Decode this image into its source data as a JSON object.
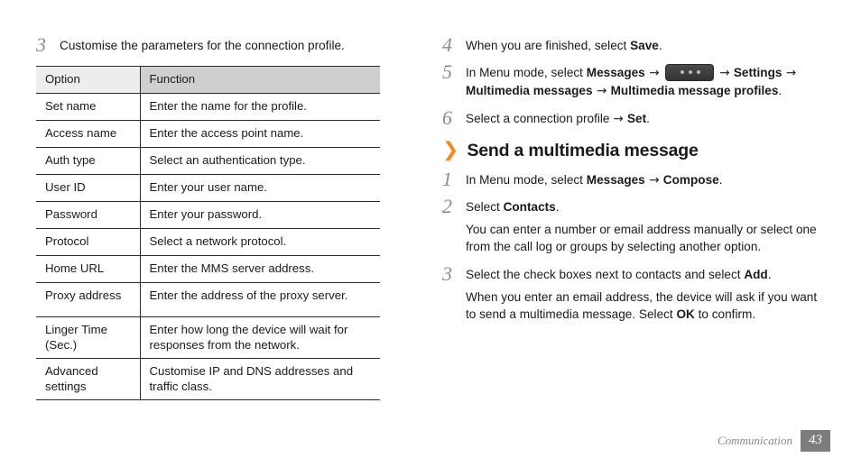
{
  "left_column": {
    "step3": {
      "number": "3",
      "text": "Customise the parameters for the connection profile."
    },
    "table": {
      "headers": [
        "Option",
        "Function"
      ],
      "rows": [
        {
          "option": "Set name",
          "function": "Enter the name for the profile.",
          "tall": false
        },
        {
          "option": "Access name",
          "function": "Enter the access point name.",
          "tall": false
        },
        {
          "option": "Auth type",
          "function": "Select an authentication type.",
          "tall": false
        },
        {
          "option": "User ID",
          "function": "Enter your user name.",
          "tall": false
        },
        {
          "option": "Password",
          "function": "Enter your password.",
          "tall": false
        },
        {
          "option": "Protocol",
          "function": "Select a network protocol.",
          "tall": false
        },
        {
          "option": "Home URL",
          "function": "Enter the MMS server address.",
          "tall": false
        },
        {
          "option": "Proxy address",
          "function": "Enter the address of the proxy server.",
          "tall": true
        },
        {
          "option": "Linger Time (Sec.)",
          "function": "Enter how long the device will wait for responses from the network.",
          "tall": true
        },
        {
          "option": "Advanced settings",
          "function": "Customise IP and DNS addresses and traffic class.",
          "tall": true
        }
      ]
    }
  },
  "right_column": {
    "step4": {
      "number": "4",
      "prefix": "When you are finished, select ",
      "bold": "Save",
      "suffix": "."
    },
    "step5": {
      "number": "5",
      "seg1": "In Menu mode, select ",
      "bold1": "Messages",
      "arrow1": " → ",
      "icon_name": "more-options-key-icon",
      "arrow2": " → ",
      "bold2": "Settings",
      "arrow3": " → ",
      "bold3": "Multimedia messages",
      "arrow4": " → ",
      "bold4": "Multimedia message profiles",
      "suffix": "."
    },
    "step6": {
      "number": "6",
      "prefix": "Select a connection profile ",
      "arrow": "→ ",
      "bold": "Set",
      "suffix": "."
    },
    "section": {
      "chevron": "❯",
      "title": "Send a multimedia message",
      "accent_color": "#F08A22"
    },
    "step1": {
      "number": "1",
      "prefix": "In Menu mode, select ",
      "bold1": "Messages",
      "arrow": " → ",
      "bold2": "Compose",
      "suffix": "."
    },
    "step2": {
      "number": "2",
      "prefix": "Select ",
      "bold": "Contacts",
      "suffix": ".",
      "note": "You can enter a number or email address manually or select one from the call log or groups by selecting another option."
    },
    "step3": {
      "number": "3",
      "prefix": "Select the check boxes next to contacts and select ",
      "bold": "Add",
      "suffix": ".",
      "note_a": "When you enter an email address, the device will ask if you want to send a multimedia message. Select ",
      "note_bold": "OK",
      "note_b": " to confirm."
    }
  },
  "footer": {
    "label": "Communication",
    "page": "43"
  }
}
